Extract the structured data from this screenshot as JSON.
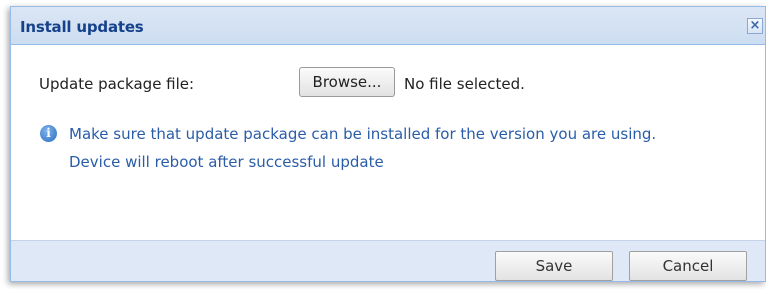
{
  "dialog": {
    "title": "Install updates",
    "close_glyph": "×",
    "close_icon": "close-icon"
  },
  "form": {
    "label": "Update package file:",
    "browse_label": "Browse...",
    "file_status": "No file selected."
  },
  "info": {
    "icon": "info-icon",
    "line1": "Make sure that update package can be installed for the version you are using.",
    "line2": "Device will reboot after successful update"
  },
  "footer": {
    "save_label": "Save",
    "cancel_label": "Cancel"
  },
  "colors": {
    "title_text": "#15428b",
    "titlebar_bg": "#d3e1f1",
    "info_text": "#2a5da8",
    "footer_bg": "#dfe8f6",
    "border": "#99bbe8"
  }
}
